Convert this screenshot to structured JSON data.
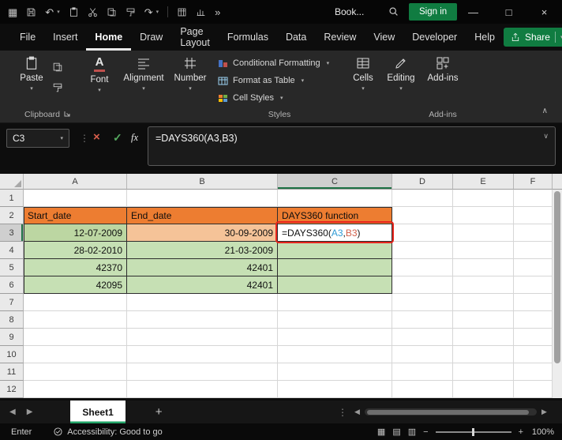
{
  "titlebar": {
    "workbook_name": "Book...",
    "sign_in_label": "Sign in"
  },
  "icons": {
    "apps": "▦",
    "caret_down": "▾",
    "chevron_down": "∨",
    "chevron_up": "∧",
    "undo": "↶",
    "redo": "↷",
    "overflow": "»",
    "dots_vertical": "⋮",
    "cancel": "×",
    "confirm": "✓",
    "nav_left": "◀",
    "nav_right": "▶",
    "plus": "+",
    "minus": "−",
    "minimize": "—",
    "maximize": "□",
    "close": "×",
    "view_normal": "▦",
    "view_page_layout": "▤",
    "view_page_break": "▥"
  },
  "ribbon": {
    "tabs": [
      "File",
      "Insert",
      "Home",
      "Draw",
      "Page Layout",
      "Formulas",
      "Data",
      "Review",
      "View",
      "Developer",
      "Help"
    ],
    "active_tab": "Home",
    "share_label": "Share",
    "buttons": {
      "paste": "Paste",
      "font": "Font",
      "font_glyph": "A",
      "alignment": "Alignment",
      "number": "Number",
      "cells": "Cells",
      "editing": "Editing",
      "addins": "Add-ins"
    },
    "styles_menu": [
      "Conditional Formatting",
      "Format as Table",
      "Cell Styles"
    ],
    "group_labels": {
      "clipboard": "Clipboard",
      "styles": "Styles",
      "addins": "Add-ins"
    }
  },
  "formula_bar": {
    "name_box": "C3",
    "fx_label": "fx",
    "formula": "=DAYS360(A3,B3)"
  },
  "grid": {
    "column_headers": [
      "A",
      "B",
      "C",
      "D",
      "E",
      "F"
    ],
    "row_headers": [
      "1",
      "2",
      "3",
      "4",
      "5",
      "6",
      "7",
      "8",
      "9",
      "10",
      "11",
      "12"
    ],
    "selected_cell": "C3",
    "cells": {
      "A2": "Start_date",
      "B2": "End_date",
      "C2": "DAYS360 function",
      "A3": "12-07-2009",
      "B3": "30-09-2009",
      "A4": "28-02-2010",
      "B4": "21-03-2009",
      "A5": "42370",
      "B5": "42401",
      "A6": "42095",
      "B6": "42401"
    },
    "c3_formula": {
      "prefix": "=DAYS360(",
      "ref1": "A3",
      "sep": ",",
      "ref2": "B3",
      "suffix": ")"
    }
  },
  "sheet_bar": {
    "sheet_name": "Sheet1"
  },
  "status_bar": {
    "mode": "Enter",
    "accessibility": "Accessibility: Good to go",
    "zoom": "100%"
  },
  "colors": {
    "accent_green": "#107C41",
    "header_fill": "#ED7D31",
    "data_fill": "#C6E0B4",
    "a3_fill": "#BCD6A2",
    "b3_fill": "#F5C398",
    "annotation_red": "#E8251D",
    "ref1_blue": "#2E9BD6",
    "ref2_red": "#D2604A"
  }
}
